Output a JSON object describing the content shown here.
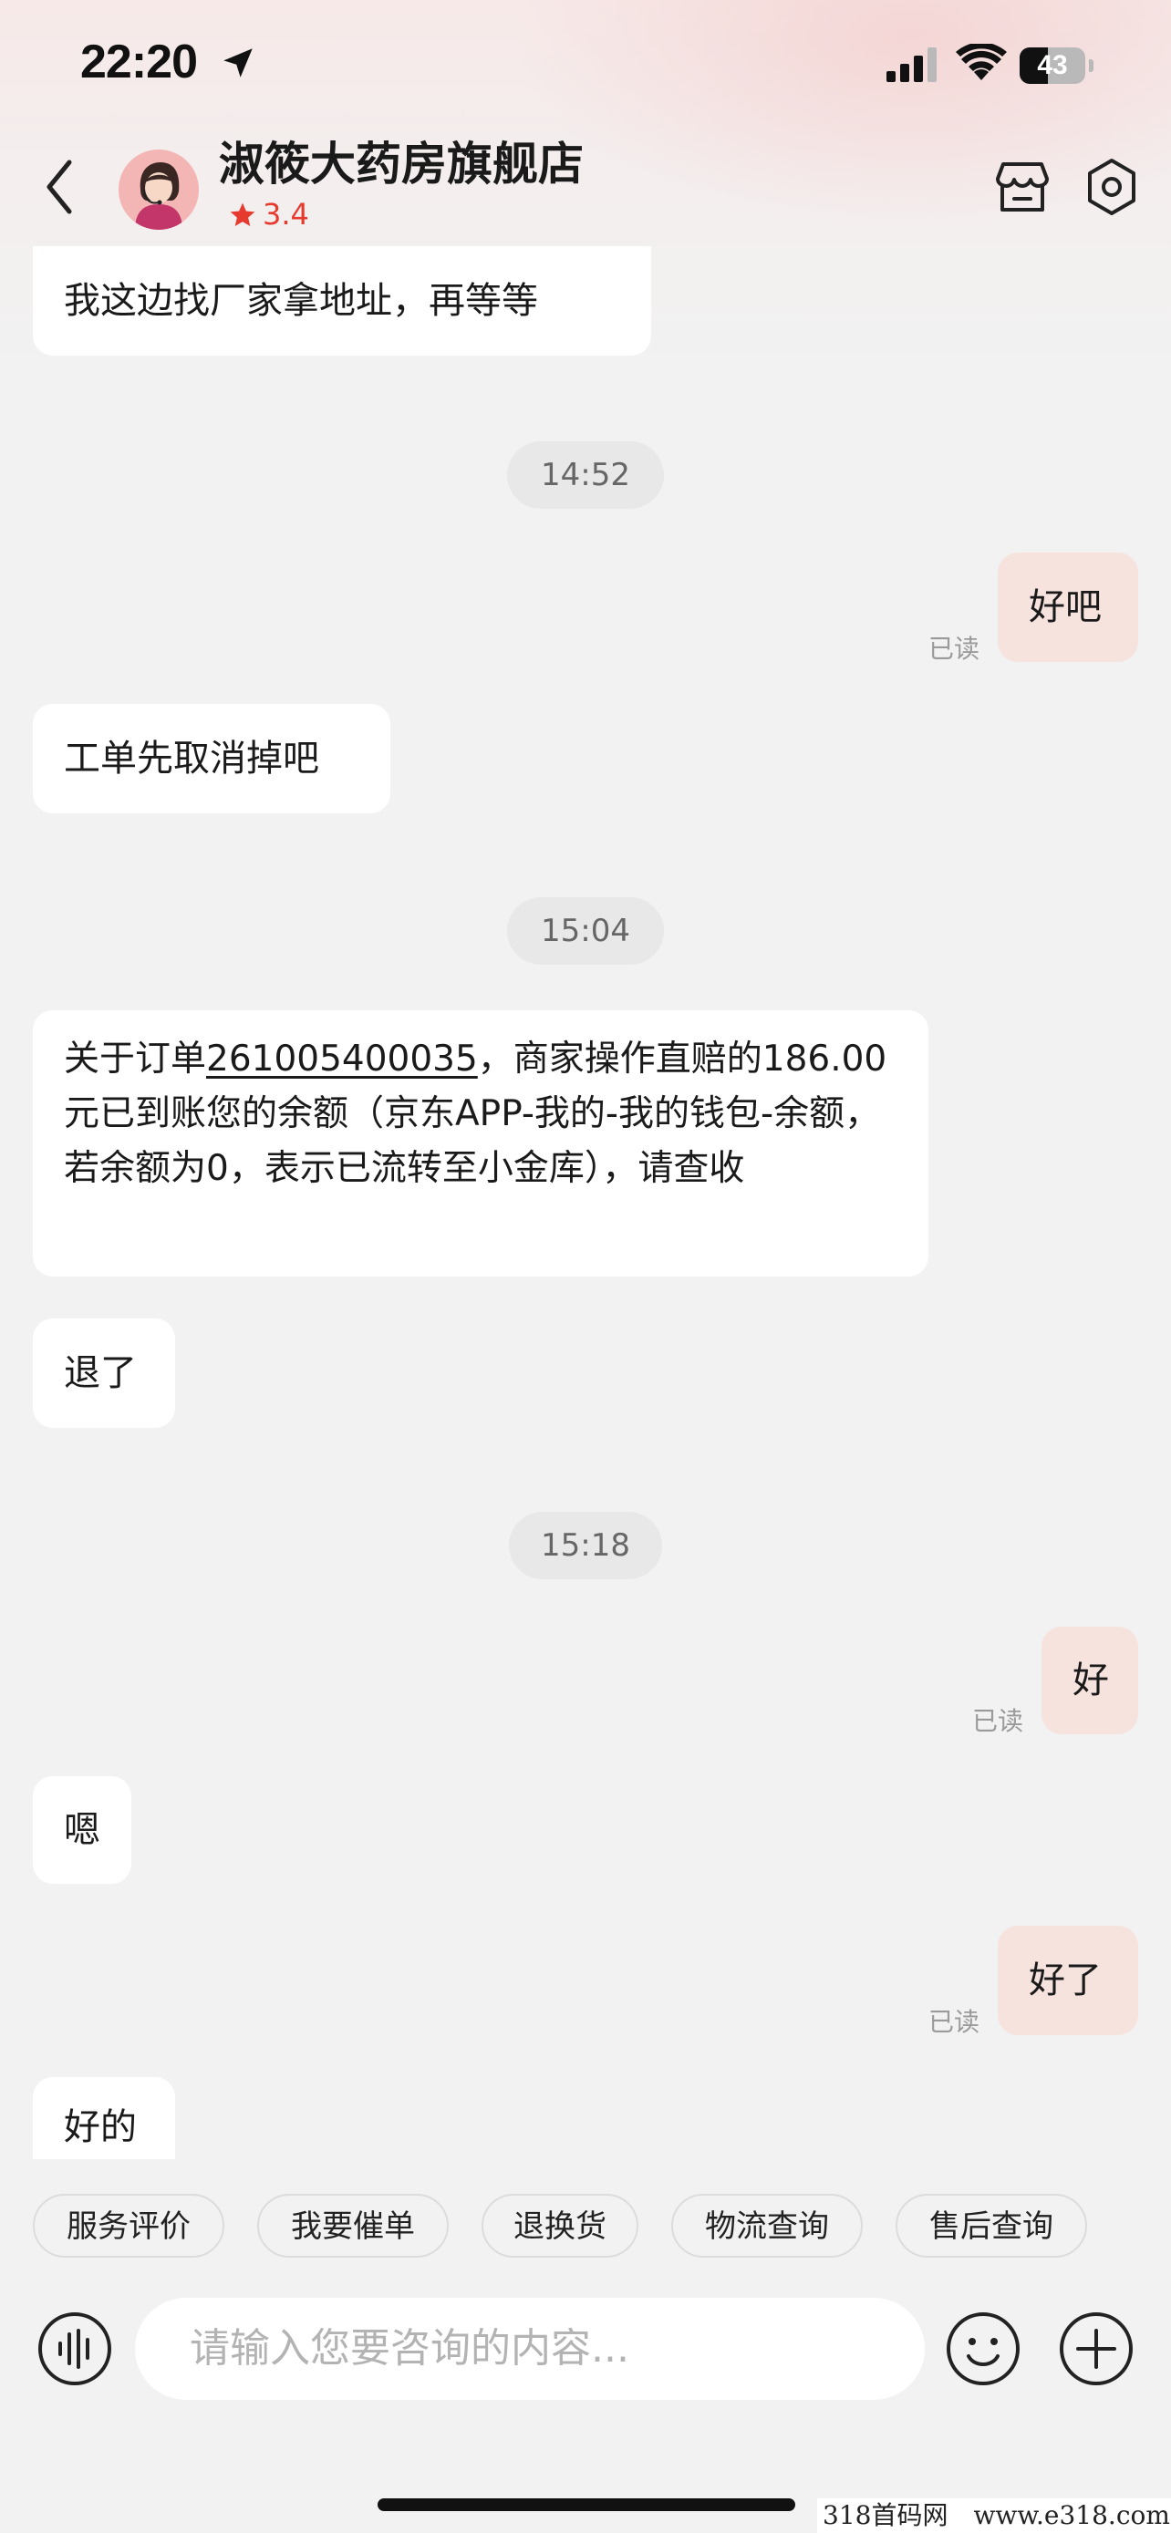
{
  "status_bar": {
    "time": "22:20",
    "battery_level": "43",
    "battery_fraction": 0.43
  },
  "header": {
    "shop_name": "淑筱大药房旗舰店",
    "rating": "3.4",
    "icons": [
      "back-icon",
      "store-icon",
      "settings-icon",
      "star-icon"
    ],
    "accent_color": "#e63a2e"
  },
  "messages": [
    {
      "side": "left",
      "text": "我这边找厂家拿地址，再等等"
    },
    {
      "type": "time",
      "text": "14:52"
    },
    {
      "side": "right",
      "text": "好吧",
      "read": "已读"
    },
    {
      "side": "left",
      "text": "工单先取消掉吧"
    },
    {
      "type": "time",
      "text": "15:04"
    },
    {
      "side": "left",
      "text_before": "关于订单",
      "order_no": "261005400035",
      "text_after": "，商家操作直赔的186.00元已到账您的余额（京东APP-我的-我的钱包-余额，若余额为0，表示已流转至小金库），请查收"
    },
    {
      "side": "left",
      "text": "退了"
    },
    {
      "type": "time",
      "text": "15:18"
    },
    {
      "side": "right",
      "text": "好",
      "read": "已读"
    },
    {
      "side": "left",
      "text": "嗯"
    },
    {
      "side": "right",
      "text": "好了",
      "read": "已读"
    },
    {
      "side": "left",
      "text": "好的"
    }
  ],
  "quick_actions": [
    "服务评价",
    "我要催单",
    "退换货",
    "物流查询",
    "售后查询"
  ],
  "input": {
    "placeholder": "请输入您要咨询的内容..."
  },
  "watermark": "318首码网　www.e318.com"
}
